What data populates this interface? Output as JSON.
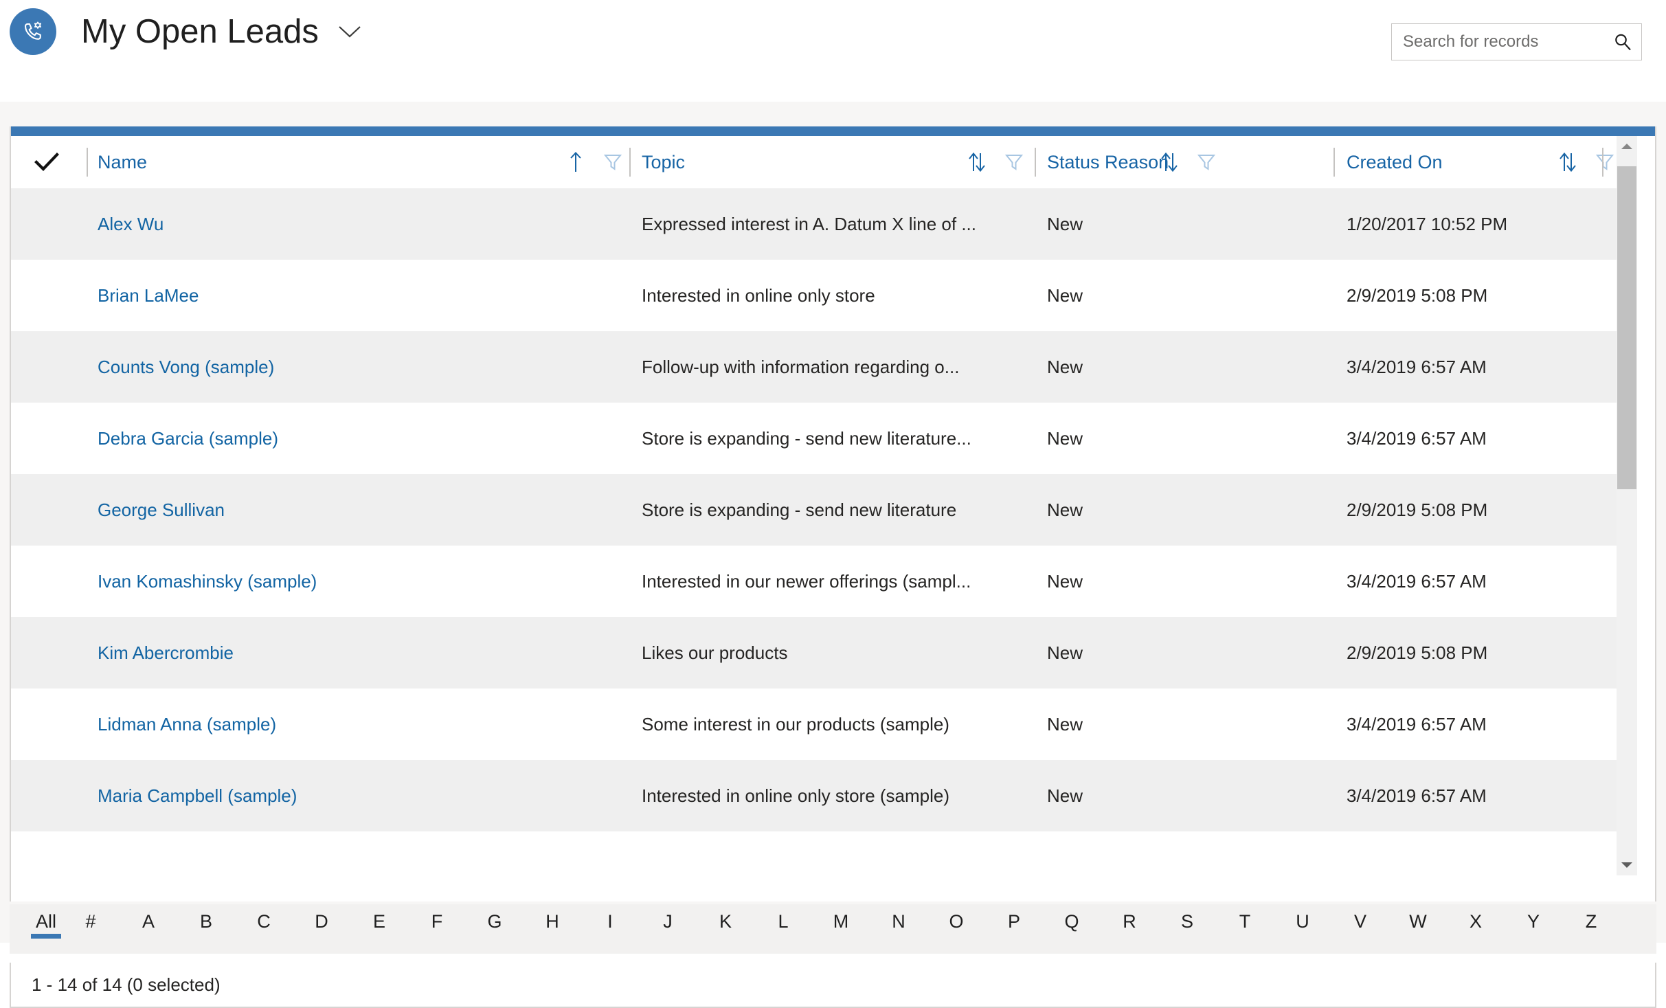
{
  "header": {
    "entity_icon": "lead-phone-icon",
    "title": "My Open Leads",
    "title_chevron_icon": "chevron-down-icon",
    "brand_color": "#3b78b4"
  },
  "search": {
    "placeholder": "Search for records",
    "value": "",
    "icon": "search-icon"
  },
  "grid": {
    "select_all_icon": "checkmark-icon",
    "columns": [
      {
        "label": "Name",
        "sort_icon": "sort-ascending-icon",
        "filter_icon": "filter-icon"
      },
      {
        "label": "Topic",
        "sort_icon": "sort-unsorted-icon",
        "filter_icon": "filter-icon"
      },
      {
        "label": "Status Reason",
        "sort_icon": "sort-unsorted-icon",
        "filter_icon": "filter-icon"
      },
      {
        "label": "Created On",
        "sort_icon": "sort-unsorted-icon",
        "filter_icon": "filter-icon"
      }
    ],
    "rows": [
      {
        "name": "Alex Wu",
        "topic": "Expressed interest in A. Datum X line of ...",
        "status": "New",
        "created": "1/20/2017 10:52 PM"
      },
      {
        "name": "Brian LaMee",
        "topic": "Interested in online only store",
        "status": "New",
        "created": "2/9/2019 5:08 PM"
      },
      {
        "name": "Counts Vong (sample)",
        "topic": "Follow-up with information regarding o...",
        "status": "New",
        "created": "3/4/2019 6:57 AM"
      },
      {
        "name": "Debra Garcia (sample)",
        "topic": "Store is expanding - send new literature...",
        "status": "New",
        "created": "3/4/2019 6:57 AM"
      },
      {
        "name": "George Sullivan",
        "topic": "Store is expanding - send new literature",
        "status": "New",
        "created": "2/9/2019 5:08 PM"
      },
      {
        "name": "Ivan Komashinsky (sample)",
        "topic": "Interested in our newer offerings (sampl...",
        "status": "New",
        "created": "3/4/2019 6:57 AM"
      },
      {
        "name": "Kim Abercrombie",
        "topic": "Likes our products",
        "status": "New",
        "created": "2/9/2019 5:08 PM"
      },
      {
        "name": "Lidman Anna (sample)",
        "topic": "Some interest in our products (sample)",
        "status": "New",
        "created": "3/4/2019 6:57 AM"
      },
      {
        "name": "Maria Campbell (sample)",
        "topic": "Interested in online only store (sample)",
        "status": "New",
        "created": "3/4/2019 6:57 AM"
      }
    ],
    "scrollbar": {
      "up_icon": "scroll-up-arrow-icon",
      "down_icon": "scroll-down-arrow-icon"
    }
  },
  "alphabet_filter": {
    "selected": "All",
    "items": [
      "All",
      "#",
      "A",
      "B",
      "C",
      "D",
      "E",
      "F",
      "G",
      "H",
      "I",
      "J",
      "K",
      "L",
      "M",
      "N",
      "O",
      "P",
      "Q",
      "R",
      "S",
      "T",
      "U",
      "V",
      "W",
      "X",
      "Y",
      "Z"
    ]
  },
  "footer": {
    "status": "1 - 14 of 14 (0 selected)"
  }
}
